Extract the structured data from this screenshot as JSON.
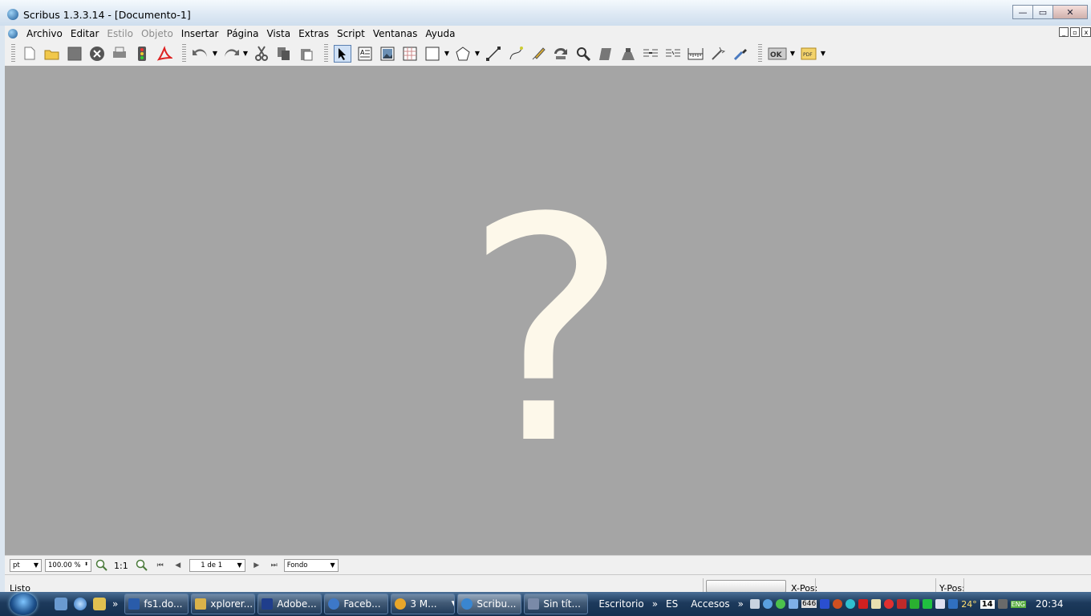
{
  "window": {
    "title": "Scribus 1.3.3.14 - [Documento-1]",
    "buttons": {
      "minimize": "—",
      "restore": "▭",
      "close": "✕"
    }
  },
  "menu": {
    "items": [
      {
        "label": "Archivo",
        "enabled": true
      },
      {
        "label": "Editar",
        "enabled": true
      },
      {
        "label": "Estilo",
        "enabled": false
      },
      {
        "label": "Objeto",
        "enabled": false
      },
      {
        "label": "Insertar",
        "enabled": true
      },
      {
        "label": "Página",
        "enabled": true
      },
      {
        "label": "Vista",
        "enabled": true
      },
      {
        "label": "Extras",
        "enabled": true
      },
      {
        "label": "Script",
        "enabled": true
      },
      {
        "label": "Ventanas",
        "enabled": true
      },
      {
        "label": "Ayuda",
        "enabled": true
      }
    ]
  },
  "toolbar": {
    "icons": [
      "new-document-icon",
      "open-folder-icon",
      "save-icon",
      "close-document-icon",
      "print-icon",
      "preflight-icon",
      "export-pdf-icon",
      "undo-icon",
      "redo-icon",
      "cut-icon",
      "copy-icon",
      "paste-icon",
      "select-pointer-icon",
      "text-frame-icon",
      "image-frame-icon",
      "table-icon",
      "shape-icon",
      "polygon-icon",
      "line-icon",
      "bezier-icon",
      "freehand-icon",
      "rotate-icon",
      "zoom-icon",
      "edit-contents-icon",
      "edit-text-icon",
      "link-frames-icon",
      "unlink-frames-icon",
      "measure-icon",
      "copy-properties-icon",
      "eyedropper-icon",
      "pdf-button-icon",
      "pdf-field-icon"
    ],
    "ok_label": "OK",
    "pdf_label": "PDF"
  },
  "canvas": {
    "placeholder": "?",
    "background": "#a5a5a5",
    "glyph_color": "#fdf8ea"
  },
  "bottombar": {
    "unit": "pt",
    "zoom": "100.00 %",
    "ratio": "1:1",
    "page": "1 de 1",
    "layer": "Fondo"
  },
  "statusbar": {
    "text": "Listo",
    "xpos_label": "X-Pos:",
    "ypos_label": "Y-Pos:"
  },
  "taskbar": {
    "chevron": "»",
    "tasks": [
      {
        "label": "fs1.do...",
        "active": false,
        "color": "#2a5caa"
      },
      {
        "label": "xplorer...",
        "active": false,
        "color": "#d9b24a"
      },
      {
        "label": "Adobe...",
        "active": false,
        "color": "#1f3e8c"
      },
      {
        "label": "Faceb...",
        "active": false,
        "color": "#3d78c8"
      },
      {
        "label": "3 M...",
        "active": false,
        "color": "#e8a62a"
      },
      {
        "label": "Scribu...",
        "active": true,
        "color": "#3a86d0"
      },
      {
        "label": "Sin tít...",
        "active": false,
        "color": "#7a8aa8"
      }
    ],
    "toolbars": [
      "Escritorio",
      "ES",
      "Accesos"
    ],
    "tray": {
      "counter": "646",
      "temp": "24°",
      "date_badge": "14",
      "lang": "ENG"
    },
    "clock": "20:34"
  }
}
